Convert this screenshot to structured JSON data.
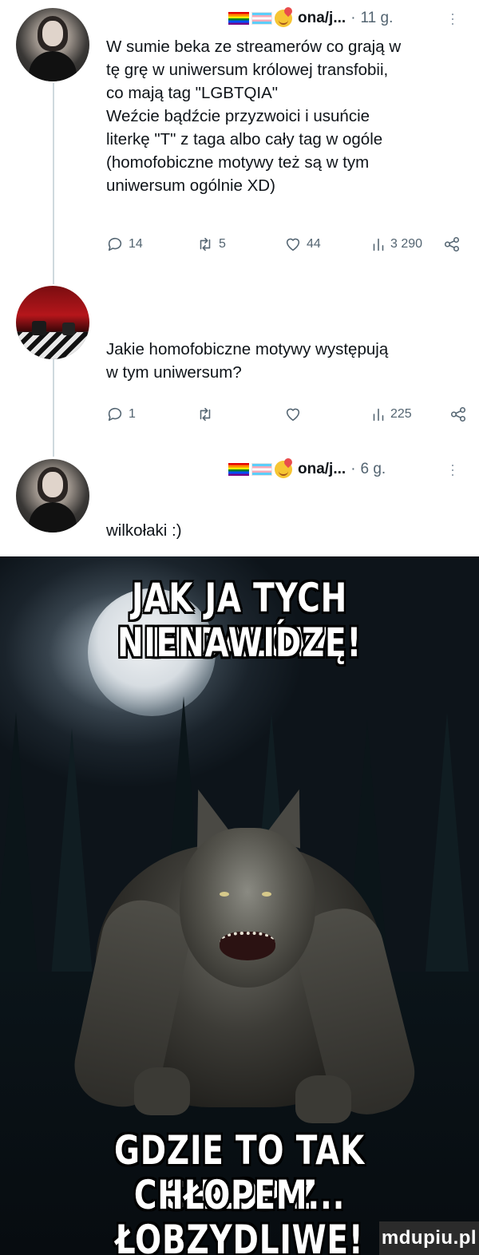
{
  "tweet1": {
    "author": "ona/j...",
    "dot": "·",
    "time": "11 g.",
    "text": "W sumie beka ze streamerów co grają w\ntę grę w uniwersum królowej transfobii,\nco mają tag \"LGBTQIA\"\nWeźcie bądźcie przyzwoici i usuńcie\nliterkę \"T\" z taga albo cały tag w ogóle\n(homofobiczne motywy też są w tym\nuniwersum ogólnie XD)",
    "replies": "14",
    "retweets": "5",
    "likes": "44",
    "views": "3 290"
  },
  "tweet2": {
    "text": "Jakie homofobiczne motywy występują\nw tym uniwersum?",
    "replies": "1",
    "views": "225"
  },
  "tweet3": {
    "author": "ona/j...",
    "dot": "·",
    "time": "6 g.",
    "text": "wilkołaki :)"
  },
  "meme": {
    "top_text_line1": "JAK JA TYCH PEDAŁÓW",
    "top_text_line2": "NIENAWIDZĘ!",
    "bottom_text_line1": "GDZIE TO TAK CHŁOP Z",
    "bottom_text_line2": "CHŁOPEM... ŁOBZYDLIWE!",
    "watermark": "mdupiu.pl"
  }
}
